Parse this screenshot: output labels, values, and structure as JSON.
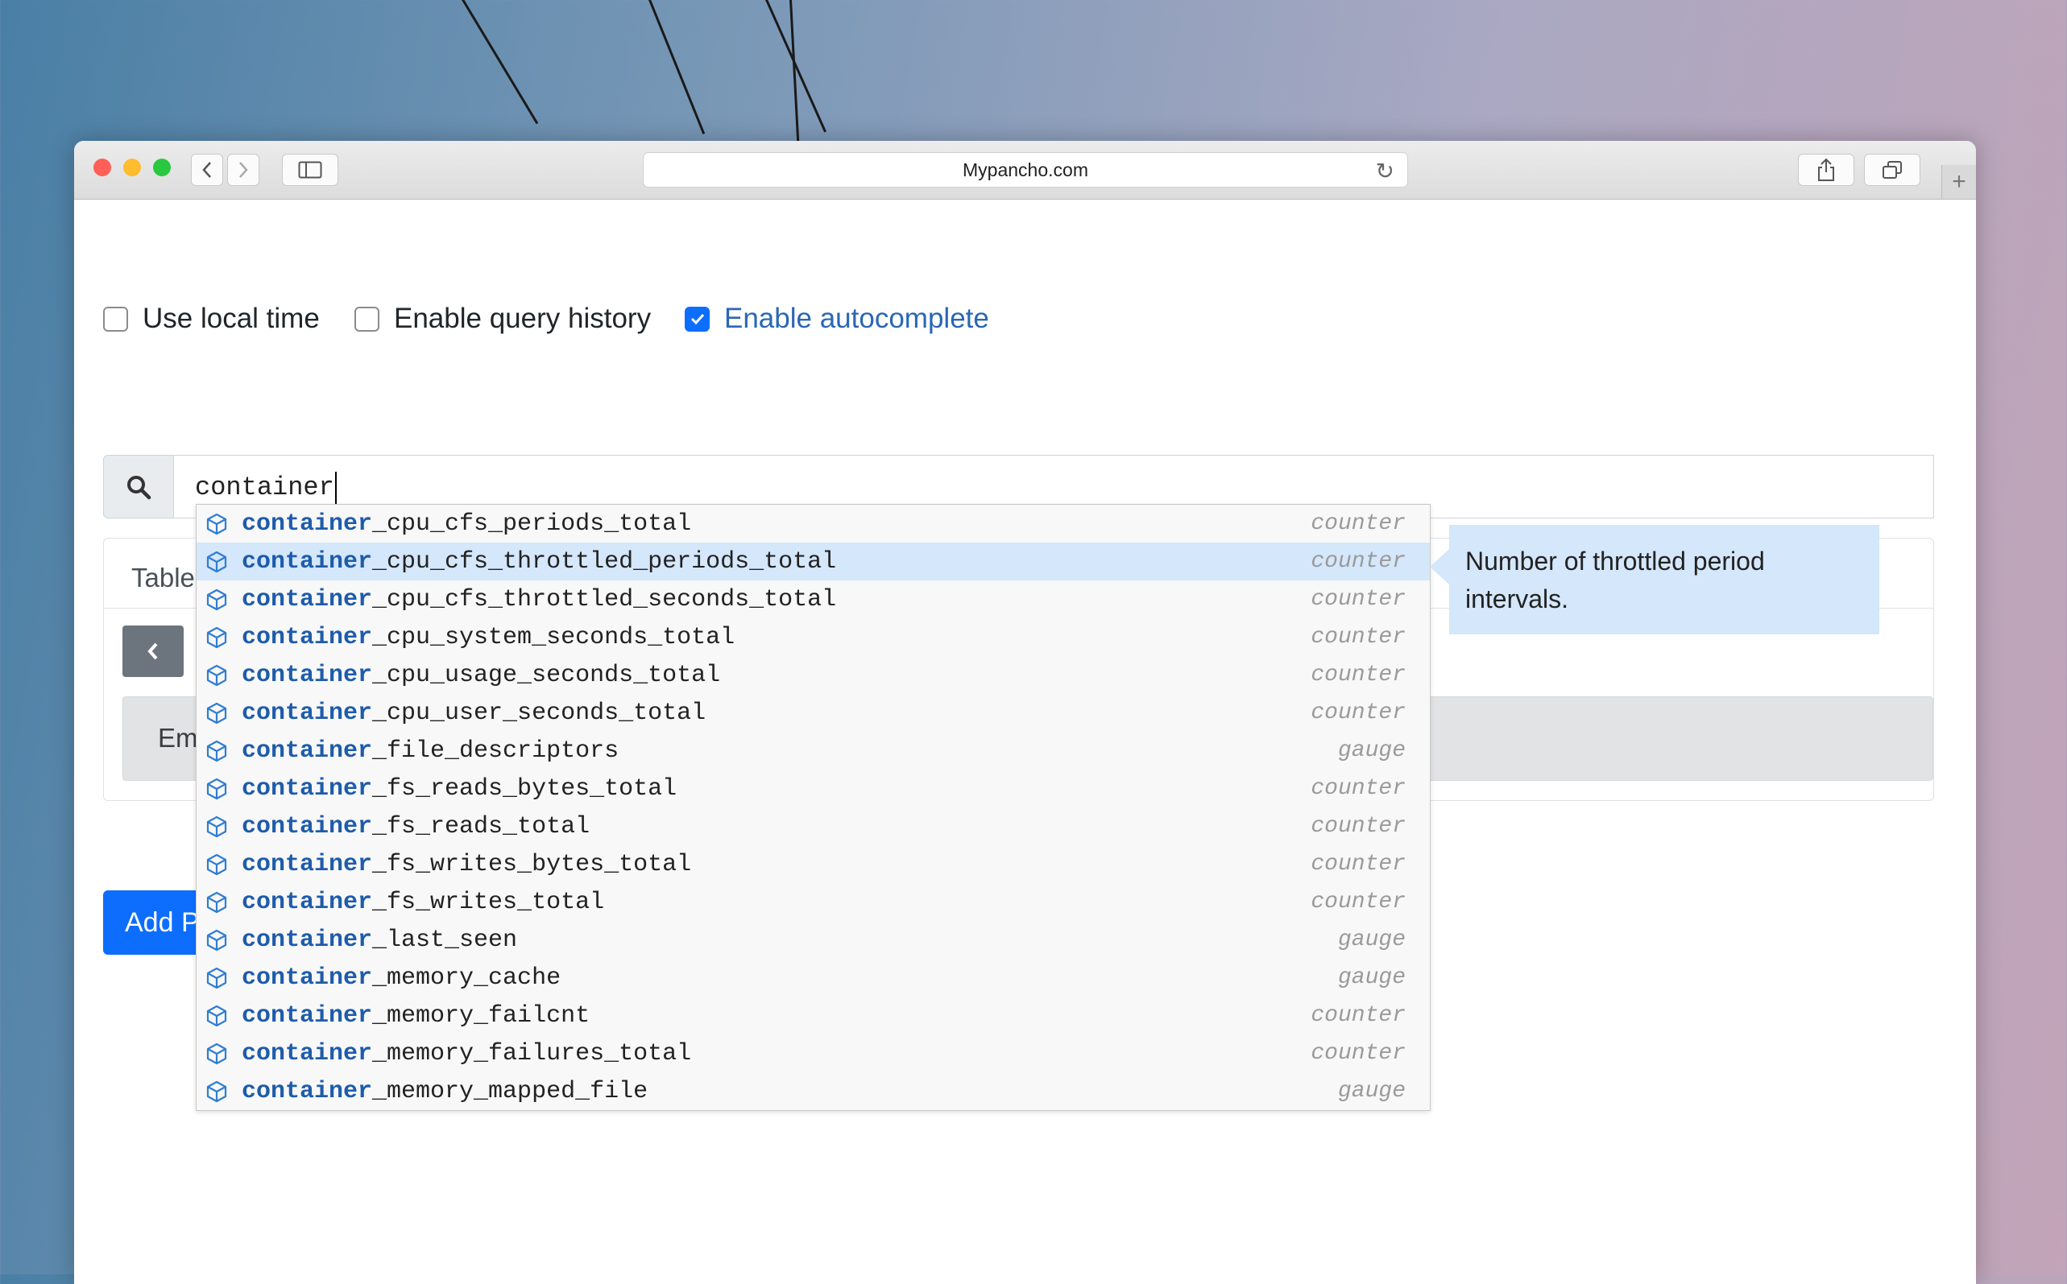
{
  "browser": {
    "url": "Mypancho.com"
  },
  "options": {
    "local_time": {
      "label": "Use local time",
      "checked": false
    },
    "query_history": {
      "label": "Enable query history",
      "checked": false
    },
    "autocomplete": {
      "label": "Enable autocomplete",
      "checked": true
    }
  },
  "query": {
    "value": "container"
  },
  "panel": {
    "tab_label": "Table",
    "empty_text": "Em",
    "add_panel_label": "Add P"
  },
  "autocomplete": {
    "match": "container",
    "items": [
      {
        "rest": "_cpu_cfs_periods_total",
        "type": "counter"
      },
      {
        "rest": "_cpu_cfs_throttled_periods_total",
        "type": "counter",
        "selected": true
      },
      {
        "rest": "_cpu_cfs_throttled_seconds_total",
        "type": "counter"
      },
      {
        "rest": "_cpu_system_seconds_total",
        "type": "counter"
      },
      {
        "rest": "_cpu_usage_seconds_total",
        "type": "counter"
      },
      {
        "rest": "_cpu_user_seconds_total",
        "type": "counter"
      },
      {
        "rest": "_file_descriptors",
        "type": "gauge"
      },
      {
        "rest": "_fs_reads_bytes_total",
        "type": "counter"
      },
      {
        "rest": "_fs_reads_total",
        "type": "counter"
      },
      {
        "rest": "_fs_writes_bytes_total",
        "type": "counter"
      },
      {
        "rest": "_fs_writes_total",
        "type": "counter"
      },
      {
        "rest": "_last_seen",
        "type": "gauge"
      },
      {
        "rest": "_memory_cache",
        "type": "gauge"
      },
      {
        "rest": "_memory_failcnt",
        "type": "counter"
      },
      {
        "rest": "_memory_failures_total",
        "type": "counter"
      },
      {
        "rest": "_memory_mapped_file",
        "type": "gauge"
      }
    ],
    "info_text": "Number of throttled period intervals."
  },
  "colors": {
    "accent": "#0d6efd",
    "match_text": "#1e5cab",
    "selected_row": "#d4e7fb"
  }
}
